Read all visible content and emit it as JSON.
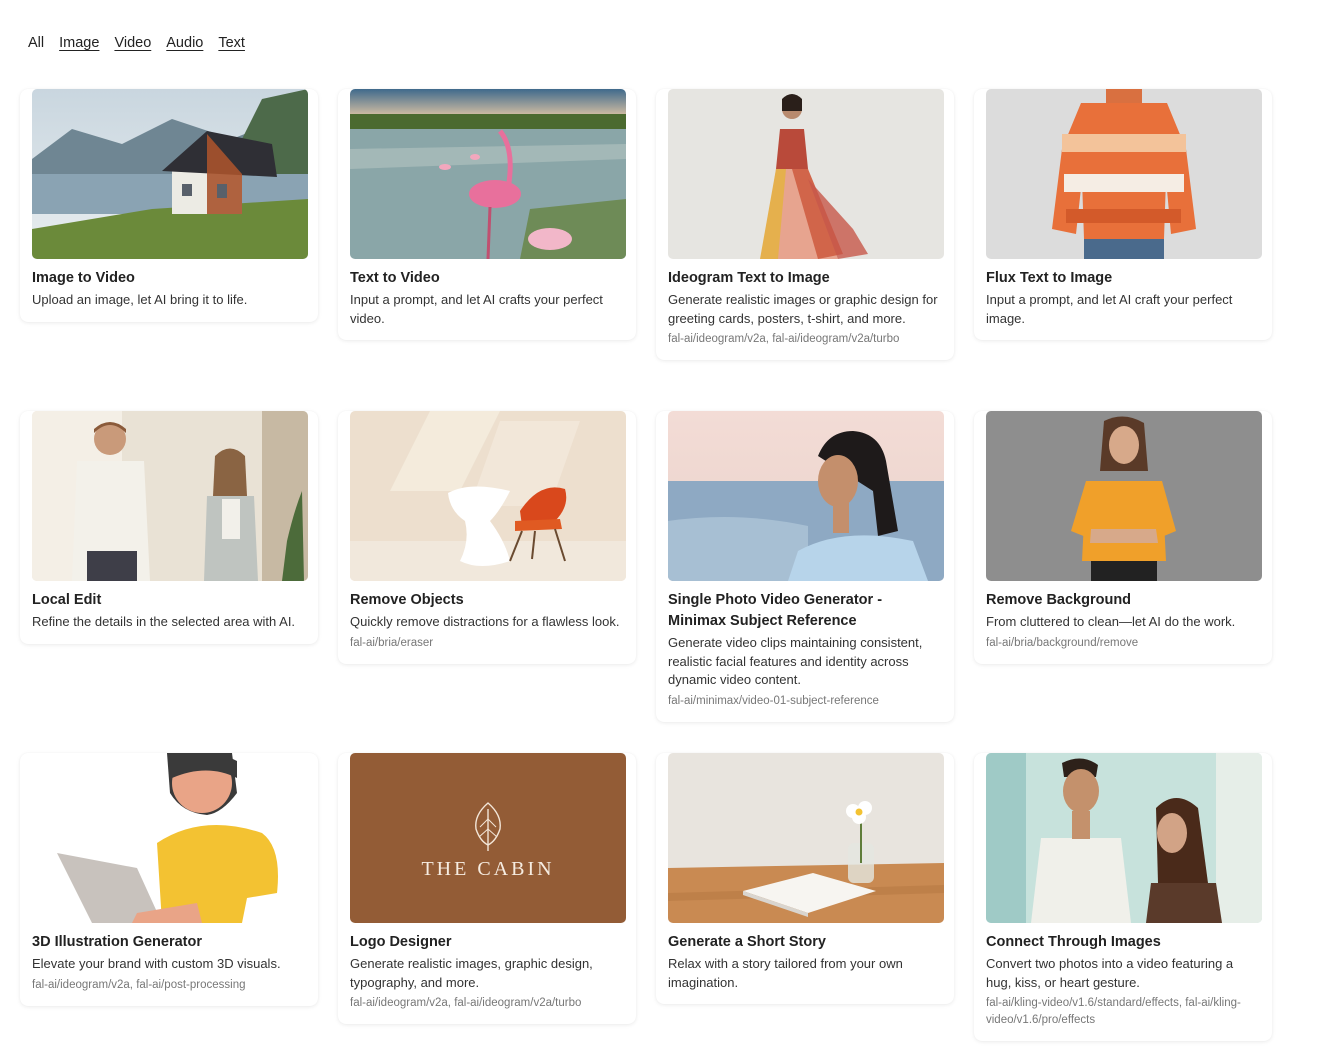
{
  "tabs": [
    "All",
    "Image",
    "Video",
    "Audio",
    "Text"
  ],
  "cards": [
    {
      "title": "Image to Video",
      "desc": "Upload an image, let AI bring it to life.",
      "meta": ""
    },
    {
      "title": "Text to Video",
      "desc": "Input a prompt, and let AI crafts your perfect video.",
      "meta": ""
    },
    {
      "title": "Ideogram Text to Image",
      "desc": "Generate realistic images or graphic design for greeting cards, posters, t-shirt, and more.",
      "meta": "fal-ai/ideogram/v2a, fal-ai/ideogram/v2a/turbo"
    },
    {
      "title": "Flux Text to Image",
      "desc": "Input a prompt, and let AI craft your perfect image.",
      "meta": ""
    },
    {
      "title": "Local Edit",
      "desc": "Refine the details in the selected area with AI.",
      "meta": ""
    },
    {
      "title": "Remove Objects",
      "desc": "Quickly remove distractions for a flawless look.",
      "meta": "fal-ai/bria/eraser"
    },
    {
      "title": "Single Photo Video Generator - Minimax Subject Reference",
      "desc": "Generate video clips maintaining consistent, realistic facial features and identity across dynamic video content.",
      "meta": "fal-ai/minimax/video-01-subject-reference"
    },
    {
      "title": "Remove Background",
      "desc": "From cluttered to clean—let AI do the work.",
      "meta": "fal-ai/bria/background/remove"
    },
    {
      "title": "3D Illustration Generator",
      "desc": "Elevate your brand with custom 3D visuals.",
      "meta": "fal-ai/ideogram/v2a, fal-ai/post-processing"
    },
    {
      "title": "Logo Designer",
      "desc": "Generate realistic images, graphic design, typography, and more.",
      "meta": "fal-ai/ideogram/v2a, fal-ai/ideogram/v2a/turbo"
    },
    {
      "title": "Generate a Short Story",
      "desc": "Relax with a story tailored from your own imagination.",
      "meta": ""
    },
    {
      "title": "Connect Through Images",
      "desc": "Convert two photos into a video featuring a hug, kiss, or heart gesture.",
      "meta": "fal-ai/kling-video/v1.6/standard/effects, fal-ai/kling-video/v1.6/pro/effects"
    }
  ],
  "logo_thumb_text": "THE CABIN"
}
